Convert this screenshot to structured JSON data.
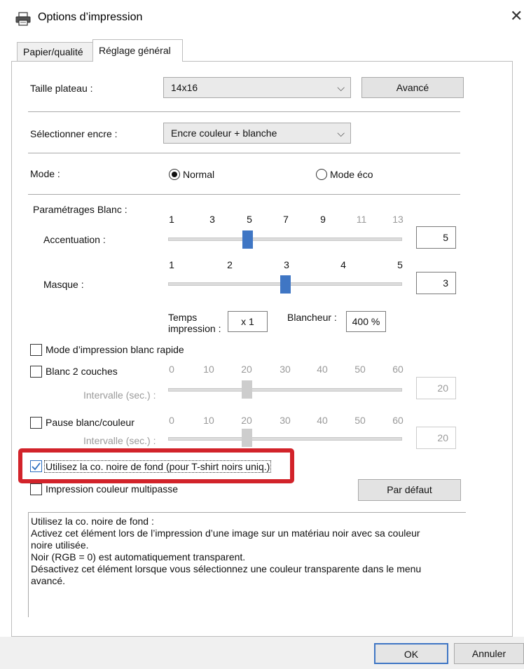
{
  "window": {
    "title": "Options d’impression",
    "close_icon": "close-icon",
    "printer_icon": "printer-icon"
  },
  "tabs": [
    {
      "label": "Papier/qualité",
      "active": false
    },
    {
      "label": "Réglage général",
      "active": true
    }
  ],
  "platen": {
    "label": "Taille plateau :",
    "value": "14x16",
    "advanced_button": "Avancé"
  },
  "ink": {
    "label": "Sélectionner encre :",
    "value": "Encre couleur + blanche"
  },
  "mode": {
    "label": "Mode :",
    "options": [
      {
        "label": "Normal",
        "selected": true
      },
      {
        "label": "Mode éco",
        "selected": false
      }
    ]
  },
  "white_settings": {
    "label": "Paramétrages Blanc :",
    "accentuation": {
      "label": "Accentuation :",
      "ticks": [
        "1",
        "3",
        "5",
        "7",
        "9",
        "11",
        "13"
      ],
      "value": "5",
      "current": 5,
      "min": 1,
      "max": 13
    },
    "mask": {
      "label": "Masque :",
      "ticks": [
        "1",
        "2",
        "3",
        "4",
        "5"
      ],
      "value": "3",
      "current": 3,
      "min": 1,
      "max": 5
    },
    "print_time": {
      "label_line1": "Temps",
      "label_line2": "impression :",
      "value": "x 1"
    },
    "whiteness": {
      "label": "Blancheur :",
      "value": "400 %"
    }
  },
  "options": {
    "fast_white": {
      "label": "Mode d’impression blanc rapide",
      "checked": false
    },
    "double_white": {
      "label": "Blanc 2 couches",
      "checked": false,
      "ticks": [
        "0",
        "10",
        "20",
        "30",
        "40",
        "50",
        "60"
      ],
      "interval_label": "Intervalle (sec.) :",
      "value": "20",
      "current": 20
    },
    "pause": {
      "label": "Pause blanc/couleur",
      "checked": false,
      "ticks": [
        "0",
        "10",
        "20",
        "30",
        "40",
        "50",
        "60"
      ],
      "interval_label": "Intervalle (sec.) :",
      "value": "20",
      "current": 20
    },
    "black_bg": {
      "label": "Utilisez la co. noire de fond (pour T-shirt noirs uniq.)",
      "checked": true
    },
    "multipass": {
      "label": "Impression couleur multipasse",
      "checked": false
    }
  },
  "default_button": "Par défaut",
  "description": [
    "Utilisez la co. noire de fond :",
    "Activez cet élément lors de l’impression d’une image sur un matériau noir avec sa couleur",
    "noire utilisée.",
    "Noir (RGB = 0) est automatiquement transparent.",
    "Désactivez cet élément lorsque vous sélectionnez une couleur transparente dans le menu",
    "avancé."
  ],
  "footer": {
    "ok": "OK",
    "cancel": "Annuler"
  },
  "colors": {
    "accent": "#3f76c4",
    "highlight": "#d2232a"
  }
}
